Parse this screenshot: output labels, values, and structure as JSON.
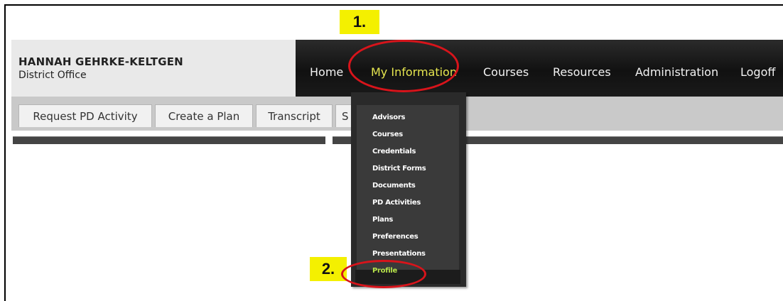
{
  "user": {
    "name": "HANNAH GEHRKE-KELTGEN",
    "office": "District Office"
  },
  "nav": {
    "items": [
      {
        "label": "Home"
      },
      {
        "label": "My Information"
      },
      {
        "label": "Courses"
      },
      {
        "label": "Resources"
      },
      {
        "label": "Administration"
      },
      {
        "label": "Logoff"
      }
    ],
    "active_color": "#e6e650"
  },
  "subtabs": [
    {
      "label": "Request PD Activity"
    },
    {
      "label": "Create a Plan"
    },
    {
      "label": "Transcript"
    },
    {
      "label": "S"
    }
  ],
  "dropdown": {
    "items": [
      {
        "label": "Advisors"
      },
      {
        "label": "Courses"
      },
      {
        "label": "Credentials"
      },
      {
        "label": "District Forms"
      },
      {
        "label": "Documents"
      },
      {
        "label": "PD Activities"
      },
      {
        "label": "Plans"
      },
      {
        "label": "Preferences"
      },
      {
        "label": "Presentations"
      },
      {
        "label": "Profile"
      }
    ],
    "highlight_color": "#b6e24a"
  },
  "annotations": {
    "step1": "1.",
    "step2": "2.",
    "badge_color": "#f4f000",
    "ring_color": "#d8141b"
  }
}
